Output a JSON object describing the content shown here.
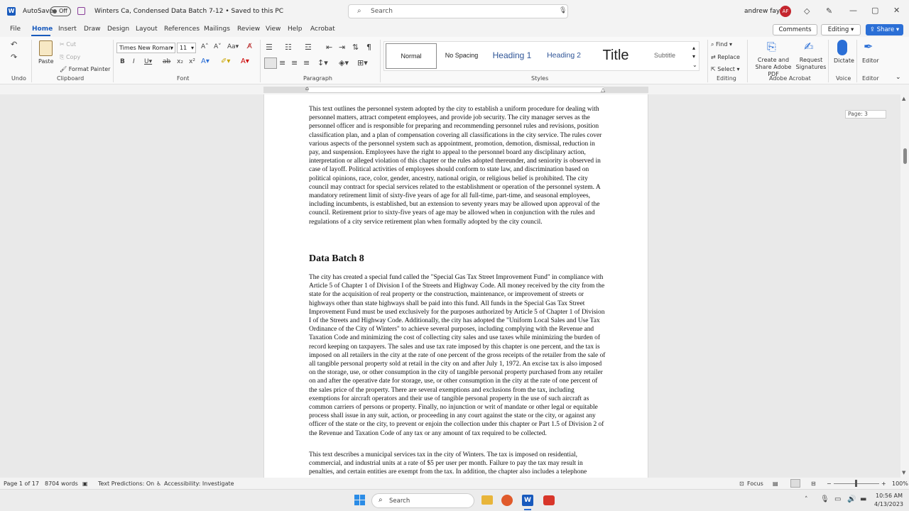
{
  "titlebar": {
    "autosave_label": "AutoSave",
    "autosave_state": "Off",
    "doc_title": "Winters Ca, Condensed Data Batch 7-12 • Saved to this PC",
    "search_placeholder": "Search",
    "user_name": "andrew fayal",
    "user_initials": "AF"
  },
  "menu": {
    "items": [
      "File",
      "Home",
      "Insert",
      "Draw",
      "Design",
      "Layout",
      "References",
      "Mailings",
      "Review",
      "View",
      "Help",
      "Acrobat"
    ],
    "active": "Home",
    "comments_label": "Comments",
    "editing_label": "Editing",
    "share_label": "Share"
  },
  "ribbon": {
    "undo_group": "Undo",
    "clipboard": {
      "paste": "Paste",
      "cut": "Cut",
      "copy": "Copy",
      "format_painter": "Format Painter",
      "group": "Clipboard"
    },
    "font": {
      "family": "Times New Roman",
      "size": "11",
      "group": "Font"
    },
    "paragraph_group": "Paragraph",
    "styles": {
      "items": [
        "Normal",
        "No Spacing",
        "Heading 1",
        "Heading 2",
        "Title",
        "Subtitle"
      ],
      "group": "Styles"
    },
    "editing": {
      "find": "Find",
      "replace": "Replace",
      "select": "Select",
      "group": "Editing"
    },
    "acrobat": {
      "create_share": "Create and Share Adobe PDF",
      "request_sig": "Request Signatures",
      "group": "Adobe Acrobat"
    },
    "voice": {
      "dictate": "Dictate",
      "group": "Voice"
    },
    "editor": {
      "label": "Editor",
      "group": "Editor"
    }
  },
  "document": {
    "page_indicator": "Page: 3",
    "para1": "This text outlines the personnel system adopted by the city to establish a uniform procedure for dealing with personnel matters, attract competent employees, and provide job security. The city manager serves as the personnel officer and is responsible for preparing and recommending personnel rules and revisions, position classification plan, and a plan of compensation covering all classifications in the city service. The rules cover various aspects of the personnel system such as appointment, promotion, demotion, dismissal, reduction in pay, and suspension. Employees have the right to appeal to the personnel board any disciplinary action, interpretation or alleged violation of this chapter or the rules adopted thereunder, and seniority is observed in case of layoff. Political activities of employees should conform to state law, and discrimination based on political opinions, race, color, gender, ancestry, national origin, or religious belief is prohibited. The city council may contract for special services related to the establishment or operation of the personnel system. A mandatory retirement limit of sixty-five years of age for all full-time, part-time, and seasonal employees, including incumbents, is established, but an extension to seventy years may be allowed upon approval of the council. Retirement prior to sixty-five years of age may be allowed when in conjunction with the rules and regulations of a city service retirement plan when formally adopted by the city council.",
    "heading": "Data Batch 8",
    "para2": "The city has created a special fund called the \"Special Gas Tax Street Improvement Fund\" in compliance with Article 5 of Chapter 1 of Division I of the Streets and Highway Code. All money received by the city from the state for the acquisition of real property or the construction, maintenance, or improvement of streets or highways other than state highways shall be paid into this fund. All funds in the Special Gas Tax Street Improvement Fund must be used exclusively for the purposes authorized by Article 5 of Chapter 1 of Division I of the Streets and Highway Code. Additionally, the city has adopted the \"Uniform Local Sales and Use Tax Ordinance of the City of Winters\" to achieve several purposes, including complying with the Revenue and Taxation Code and minimizing the cost of collecting city sales and use taxes while minimizing the burden of record keeping on taxpayers. The sales and use tax rate imposed by this chapter is one percent, and the tax is imposed on all retailers in the city at the rate of one percent of the gross receipts of the retailer from the sale of all tangible personal property sold at retail in the city on and after July 1, 1972. An excise tax is also imposed on the storage, use, or other consumption in the city of tangible personal property purchased from any retailer on and after the operative date for storage, use, or other consumption in the city at the rate of one percent of the sales price of the property. There are several exemptions and exclusions from the tax, including exemptions for aircraft operators and their use of tangible personal property in the use of such aircraft as common carriers of persons or property. Finally, no injunction or writ of mandate or other legal or equitable process shall issue in any suit, action, or proceeding in any court against the state or the city, or against any officer of the state or the city, to prevent or enjoin the collection under this chapter or Part 1.5 of Division 2 of the Revenue and Taxation Code of any tax or any amount of tax required to be collected.",
    "para3": "This text describes a municipal services tax in the city of Winters. The tax is imposed on residential, commercial, and industrial units at a rate of $5 per user per month. Failure to pay the tax may result in penalties, and certain entities are exempt from the tax. In addition, the chapter also includes a telephone"
  },
  "status": {
    "page": "Page 1 of 17",
    "words": "8704 words",
    "predictions": "Text Predictions: On",
    "accessibility": "Accessibility: Investigate",
    "focus": "Focus",
    "zoom": "100%"
  },
  "taskbar": {
    "search": "Search",
    "time": "10:56 AM",
    "date": "4/13/2023"
  },
  "colors": {
    "accent": "#2b6fd6",
    "word_blue": "#185abd",
    "avatar": "#c4262e"
  }
}
